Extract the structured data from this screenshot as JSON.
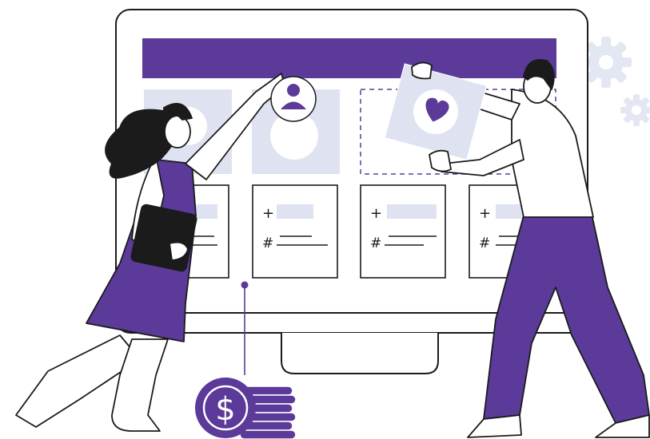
{
  "scene": {
    "colors": {
      "purple": "#5b3a99",
      "light_slot": "#dfe3f1",
      "gear_color": "#e3e7f2",
      "stroke": "#1b1b1b",
      "background": "#ffffff"
    },
    "cards": [
      {
        "plus_glyph": "+",
        "hash_glyph": "#"
      },
      {
        "plus_glyph": "+",
        "hash_glyph": "#"
      },
      {
        "plus_glyph": "+",
        "hash_glyph": "#"
      },
      {
        "plus_glyph": "+",
        "hash_glyph": "#"
      }
    ],
    "coin": {
      "currency_symbol": "$"
    }
  }
}
